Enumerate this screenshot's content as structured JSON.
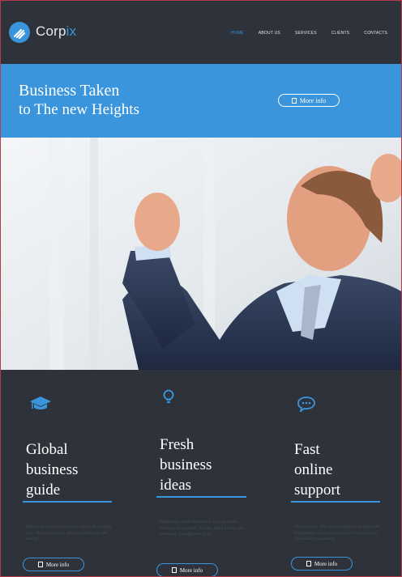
{
  "brand": {
    "name_main": "Corp",
    "name_accent": "ix"
  },
  "nav": {
    "items": [
      {
        "label": "Home"
      },
      {
        "label": "About us"
      },
      {
        "label": "Services"
      },
      {
        "label": "Clients"
      },
      {
        "label": "Contacts"
      }
    ]
  },
  "hero": {
    "line1": "Business Taken",
    "line2": "to The new Heights",
    "button_label": "More info"
  },
  "features": [
    {
      "title": "Global\nbusiness\nguide",
      "text": "Setting up your own business can be an exciting time. Before you start, give yourself time and money",
      "button_label": "More info",
      "icon": "graduation-cap-icon"
    },
    {
      "title": "Fresh\nbusiness\nideas",
      "text": "Operating a small business is not just about working for yourself; it's also about having the necessary management skills",
      "button_label": "More info",
      "icon": "lightbulb-icon"
    },
    {
      "title": "Fast\nonline\nsupport",
      "text": "We're here to offer the best support, to help you troubleshoot any business issues. Get started to find reliable assistance",
      "button_label": "More info",
      "icon": "chat-bubble-icon"
    }
  ],
  "colors": {
    "accent": "#3a95dc",
    "dark": "#2e333b"
  }
}
